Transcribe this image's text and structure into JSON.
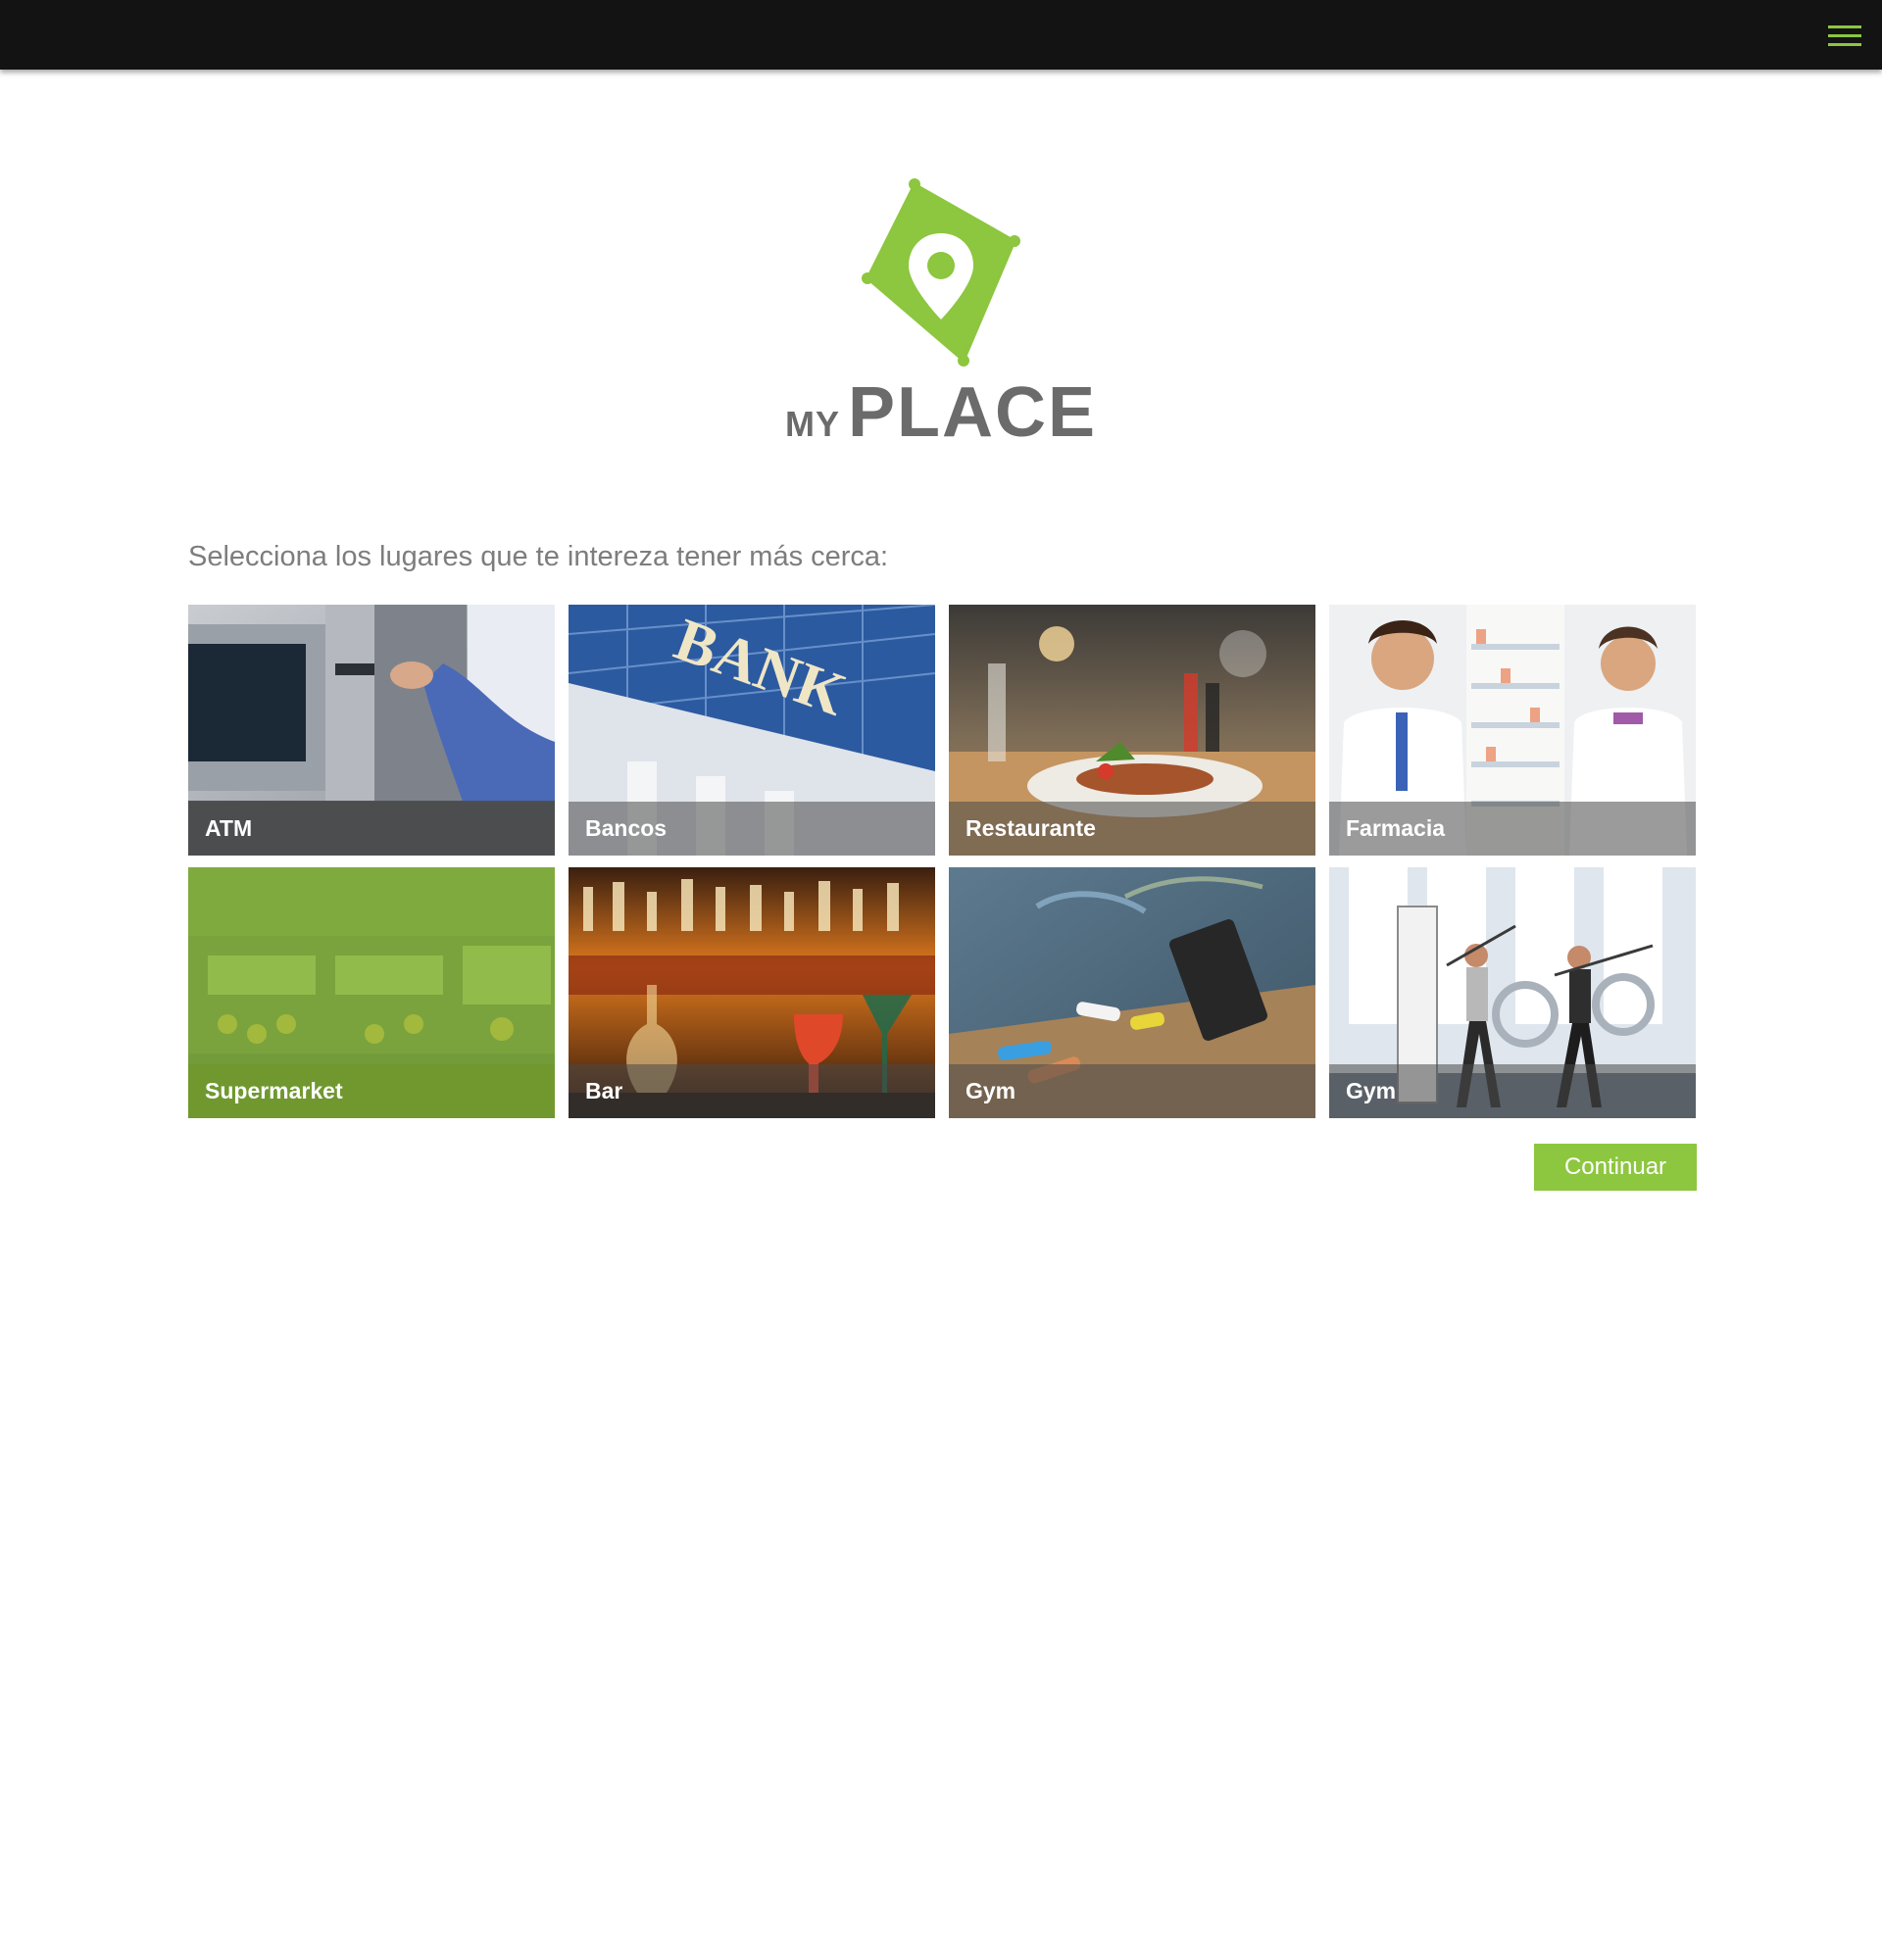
{
  "header": {
    "menu_icon": "hamburger-menu-icon",
    "accent_color": "#8dc63f",
    "background": "#131313"
  },
  "logo": {
    "my": "MY",
    "place": "PLACE",
    "icon": "map-pin-icon",
    "color": "#8dc63f",
    "text_color": "#6b6b6b"
  },
  "prompt": "Selecciona los lugares que te intereza tener más cerca:",
  "categories": [
    {
      "label": "ATM",
      "selected": false
    },
    {
      "label": "Bancos",
      "selected": false
    },
    {
      "label": "Restaurante",
      "selected": false
    },
    {
      "label": "Farmacia",
      "selected": false
    },
    {
      "label": "Supermarket",
      "selected": true
    },
    {
      "label": "Bar",
      "selected": false
    },
    {
      "label": "Gym",
      "selected": false
    },
    {
      "label": "Gym",
      "selected": false
    }
  ],
  "continue_label": "Continuar"
}
